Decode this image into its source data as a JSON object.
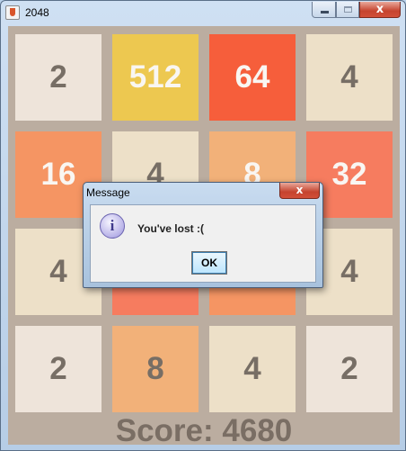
{
  "window": {
    "title": "2048",
    "close_label": "x"
  },
  "board": {
    "background": "#bbada0",
    "tiles": [
      [
        {
          "value": "2",
          "bg": "#eee4da",
          "fg": "#776e65"
        },
        {
          "value": "512",
          "bg": "#edc850",
          "fg": "#f9f6f2"
        },
        {
          "value": "64",
          "bg": "#f65e3b",
          "fg": "#f9f6f2"
        },
        {
          "value": "4",
          "bg": "#ede0c8",
          "fg": "#776e65"
        }
      ],
      [
        {
          "value": "16",
          "bg": "#f59563",
          "fg": "#f9f6f2"
        },
        {
          "value": "4",
          "bg": "#ede0c8",
          "fg": "#776e65"
        },
        {
          "value": "8",
          "bg": "#f2b179",
          "fg": "#f9f6f2"
        },
        {
          "value": "32",
          "bg": "#f67c5f",
          "fg": "#f9f6f2"
        }
      ],
      [
        {
          "value": "4",
          "bg": "#ede0c8",
          "fg": "#776e65"
        },
        {
          "value": "",
          "bg": "#f67c5f",
          "fg": "#f9f6f2"
        },
        {
          "value": "",
          "bg": "#f59563",
          "fg": "#f9f6f2"
        },
        {
          "value": "4",
          "bg": "#ede0c8",
          "fg": "#776e65"
        }
      ],
      [
        {
          "value": "2",
          "bg": "#eee4da",
          "fg": "#776e65"
        },
        {
          "value": "8",
          "bg": "#f2b179",
          "fg": "#776e65"
        },
        {
          "value": "4",
          "bg": "#ede0c8",
          "fg": "#776e65"
        },
        {
          "value": "2",
          "bg": "#eee4da",
          "fg": "#776e65"
        }
      ]
    ],
    "score_text": "Score: 4680"
  },
  "dialog": {
    "title": "Message",
    "close_label": "x",
    "icon": "info-icon",
    "icon_glyph": "i",
    "message": "You've lost :(",
    "ok_label": "OK"
  }
}
